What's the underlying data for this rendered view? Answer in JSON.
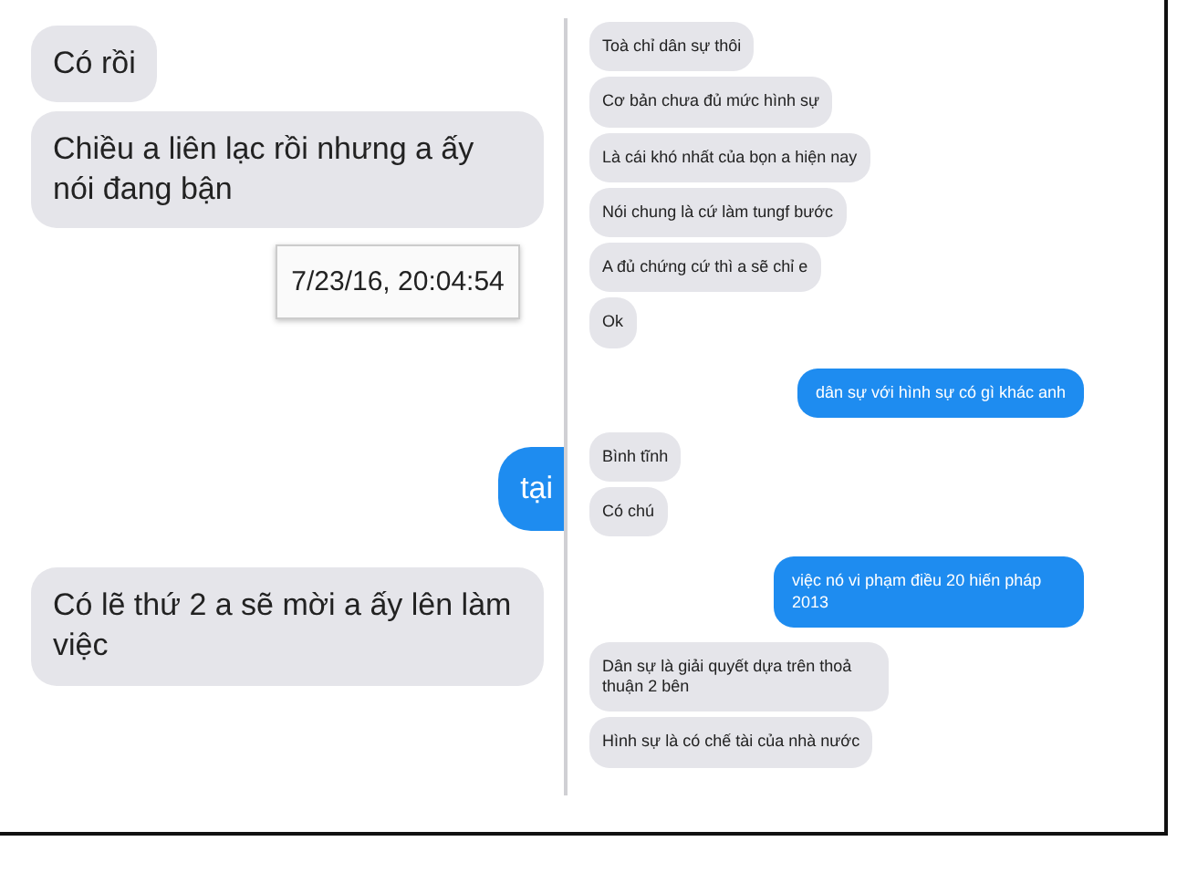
{
  "panels": [
    {
      "messages": [
        {
          "kind": "received",
          "text": "Có rồi"
        },
        {
          "kind": "received",
          "text": "Chiều a liên lạc rồi nhưng a ấy nói đang bận"
        },
        {
          "kind": "timestamp",
          "text": "7/23/16, 20:04:54"
        },
        {
          "kind": "sent",
          "text": "tại"
        },
        {
          "kind": "received",
          "text": "Có lẽ thứ 2 a sẽ mời a ấy lên làm việc"
        }
      ]
    },
    {
      "messages": [
        {
          "kind": "received",
          "text": "Toà chỉ dân sự thôi"
        },
        {
          "kind": "received",
          "text": "Cơ bản chưa đủ mức hình sự"
        },
        {
          "kind": "received",
          "text": "Là cái khó nhất của bọn a hiện nay"
        },
        {
          "kind": "received",
          "text": "Nói chung là cứ làm tungf bước"
        },
        {
          "kind": "received",
          "text": "A đủ chứng cứ thì a sẽ chỉ e"
        },
        {
          "kind": "received",
          "text": "Ok"
        },
        {
          "kind": "sent",
          "text": "dân sự với hình sự có gì khác anh"
        },
        {
          "kind": "received",
          "text": "Bình tĩnh"
        },
        {
          "kind": "received",
          "text": "Có chú"
        },
        {
          "kind": "sent",
          "text": "việc nó vi phạm điều 20 hiến pháp 2013"
        },
        {
          "kind": "received",
          "text": "Dân sự là giải quyết dựa trên thoả thuận 2 bên"
        },
        {
          "kind": "received",
          "text": "Hình sự là có chế tài của nhà nước"
        }
      ]
    }
  ]
}
